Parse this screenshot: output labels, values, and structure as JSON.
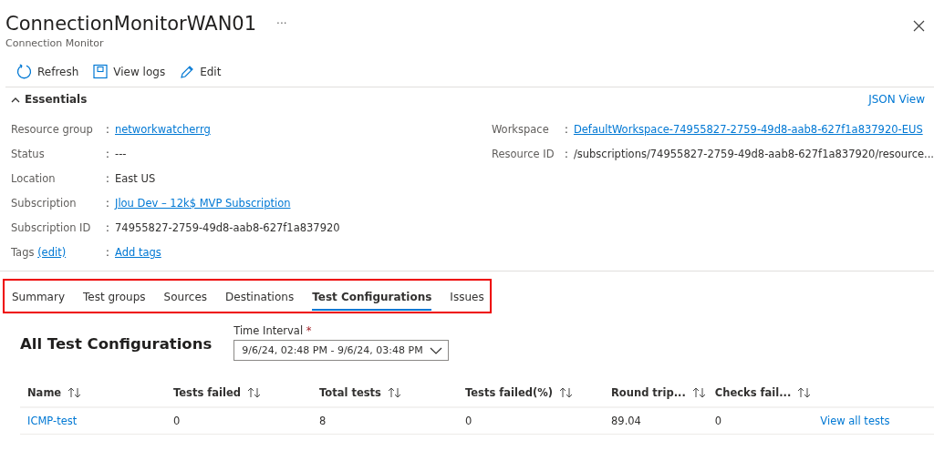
{
  "header": {
    "title": "ConnectionMonitorWAN01",
    "more": "···",
    "subtitle": "Connection Monitor"
  },
  "toolbar": [
    {
      "kind": "refresh",
      "label": "Refresh"
    },
    {
      "kind": "logs",
      "label": "View logs"
    },
    {
      "kind": "edit",
      "label": "Edit"
    }
  ],
  "essentials": {
    "title": "Essentials",
    "separator": ":",
    "expanded": true,
    "json_view": "JSON View",
    "left": [
      {
        "label": "Resource group",
        "value": "networkwatcherrg",
        "kind": "link"
      },
      {
        "label": "Status",
        "value": "---",
        "kind": "text"
      },
      {
        "label": "Location",
        "value": "East US",
        "kind": "text"
      },
      {
        "label": "Subscription",
        "value": "Jlou Dev – 12k$ MVP Subscription",
        "kind": "link"
      },
      {
        "label": "Subscription ID",
        "value": "74955827-2759-49d8-aab8-627f1a837920",
        "kind": "text"
      }
    ],
    "tags": {
      "label": "Tags",
      "edit": "(edit)",
      "value": "Add tags"
    },
    "right": [
      {
        "label": "Workspace",
        "value": "DefaultWorkspace-74955827-2759-49d8-aab8-627f1a837920-EUS",
        "kind": "link"
      },
      {
        "label": "Resource ID",
        "value": "/subscriptions/74955827-2759-49d8-aab8-627f1a837920/resource...",
        "kind": "text"
      }
    ]
  },
  "tabs": [
    {
      "label": "Summary",
      "selected": false
    },
    {
      "label": "Test groups",
      "selected": false
    },
    {
      "label": "Sources",
      "selected": false
    },
    {
      "label": "Destinations",
      "selected": false
    },
    {
      "label": "Test Configurations",
      "selected": true
    },
    {
      "label": "Issues",
      "selected": false
    }
  ],
  "section": {
    "title": "All Test Configurations",
    "time_interval": {
      "label": "Time Interval",
      "required": "*",
      "value": "9/6/24, 02:48 PM - 9/6/24, 03:48 PM"
    }
  },
  "table": {
    "columns": [
      "Name",
      "Tests failed",
      "Total tests",
      "Tests failed(%)",
      "Round trip...",
      "Checks fail..."
    ],
    "rows": [
      {
        "cells": [
          "ICMP-test",
          "0",
          "8",
          "0",
          "89.04",
          "0"
        ],
        "action": "View all tests"
      }
    ]
  }
}
